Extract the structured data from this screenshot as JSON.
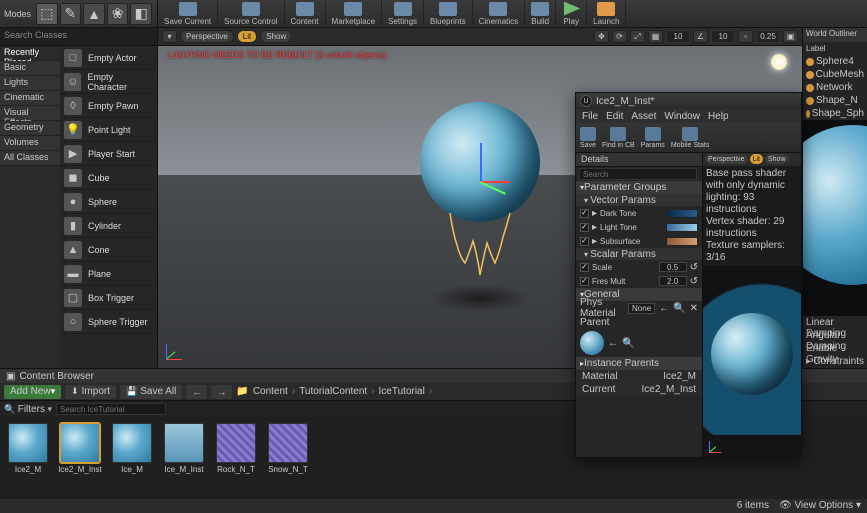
{
  "toolbar": {
    "modes_label": "Modes",
    "buttons": [
      {
        "label": "Save Current"
      },
      {
        "label": "Source Control"
      },
      {
        "label": "Content"
      },
      {
        "label": "Marketplace"
      },
      {
        "label": "Settings"
      },
      {
        "label": "Blueprints"
      },
      {
        "label": "Cinematics"
      },
      {
        "label": "Build"
      },
      {
        "label": "Play"
      },
      {
        "label": "Launch"
      }
    ]
  },
  "left_panel": {
    "search_placeholder": "Search Classes",
    "categories": [
      "Recently Placed",
      "Basic",
      "Lights",
      "Cinematic",
      "Visual Effects",
      "Geometry",
      "Volumes",
      "All Classes"
    ],
    "actors": [
      "Empty Actor",
      "Empty Character",
      "Empty Pawn",
      "Point Light",
      "Player Start",
      "Cube",
      "Sphere",
      "Cylinder",
      "Cone",
      "Plane",
      "Box Trigger",
      "Sphere Trigger"
    ]
  },
  "viewport": {
    "perspective": "Perspective",
    "lit": "Lit",
    "show": "Show",
    "warning": "LIGHTING NEEDS TO BE REBUILT (3 unbuilt objects)",
    "snap_angle": "10",
    "snap_grid": "10",
    "cam_speed": "0.25"
  },
  "outliner": {
    "title": "World Outliner",
    "label_col": "Label",
    "items": [
      "Sphere4",
      "CubeMesh",
      "Network",
      "Shape_N",
      "Shape_Sph"
    ]
  },
  "details_side": {
    "rows": [
      "Linear Damping",
      "Angular Damping",
      "Enable Gravity",
      "Constraints"
    ]
  },
  "mat_inst": {
    "title": "Ice2_M_Inst*",
    "menu": [
      "File",
      "Edit",
      "Asset",
      "Window",
      "Help"
    ],
    "tools": [
      "Save",
      "Find in CB",
      "Params",
      "Mobile Stats"
    ],
    "details_tab": "Details",
    "search_placeholder": "Search",
    "param_groups": "Parameter Groups",
    "vector_params": "Vector Params",
    "vectors": [
      {
        "name": "Dark Tone",
        "checked": true
      },
      {
        "name": "Light Tone",
        "checked": true
      },
      {
        "name": "Subsurface",
        "checked": true
      }
    ],
    "scalar_params": "Scalar Params",
    "scalars": [
      {
        "name": "Scale",
        "checked": true,
        "value": "0.5"
      },
      {
        "name": "Fres Mult",
        "checked": true,
        "value": "2.0"
      }
    ],
    "general": "General",
    "phys_material": "Phys Material",
    "phys_value": "None",
    "parent_lbl": "Parent",
    "instance_parents": "Instance Parents",
    "material_lbl": "Material",
    "material_val": "Ice2_M",
    "current_lbl": "Current",
    "current_val": "Ice2_M_Inst",
    "preview": {
      "persp": "Perspective",
      "lit": "Lit",
      "show": "Show",
      "info1": "Base pass shader with only dynamic lighting: 93 instructions",
      "info2": "Vertex shader: 29 instructions",
      "info3": "Texture samplers: 3/16"
    }
  },
  "content_browser": {
    "title": "Content Browser",
    "add_new": "Add New",
    "import": "Import",
    "save_all": "Save All",
    "path": [
      "Content",
      "TutorialContent",
      "IceTutorial"
    ],
    "filters": "Filters",
    "search_placeholder": "Search IceTutorial",
    "assets": [
      {
        "name": "Ice2_M",
        "kind": "sphere"
      },
      {
        "name": "Ice2_M_Inst",
        "kind": "sphere",
        "selected": true
      },
      {
        "name": "Ice_M",
        "kind": "sphere"
      },
      {
        "name": "Ice_M_Inst",
        "kind": "flat"
      },
      {
        "name": "Rock_N_T",
        "kind": "noise"
      },
      {
        "name": "Snow_N_T",
        "kind": "noise"
      }
    ],
    "items_count": "6 items",
    "view_options": "View Options"
  }
}
